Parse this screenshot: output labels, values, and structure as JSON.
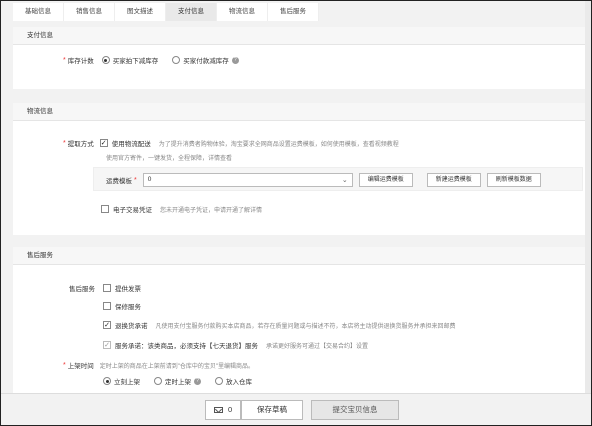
{
  "tabs": [
    {
      "label": "基础信息"
    },
    {
      "label": "销售信息"
    },
    {
      "label": "图文描述"
    },
    {
      "label": "支付信息"
    },
    {
      "label": "物流信息"
    },
    {
      "label": "售后服务"
    }
  ],
  "payment": {
    "title": "支付信息",
    "stock_label": "库存计数",
    "opt1": "买家拍下减库存",
    "opt2": "买家付款减库存"
  },
  "logistics": {
    "title": "物流信息",
    "method_label": "提取方式",
    "use_logistics": "使用物流配送",
    "desc": "为了提升消费者购物体验，淘宝要求全网商品设置运费模板，如何使用模板，查看视频教程",
    "desc2": "使用官方寄件，一键发货，全程保障，详情查看",
    "template_label": "运费模板",
    "template_value": "0",
    "btn_edit": "编辑运费模板",
    "btn_new": "新建运费模板",
    "btn_refresh": "刷新模板数据",
    "voucher_label": "电子交易凭证",
    "voucher_hint": "您未开通电子凭证，申请开通了解详情"
  },
  "after_sales": {
    "title": "售后服务",
    "service_label": "售后服务",
    "invoice": "提供发票",
    "warranty": "保修服务",
    "return_promise": "退换货承诺",
    "return_hint": "凡使用支付宝服务付款购买本店商品，若存在质量问题或与描述不符，本店将主动提供退换货服务并承担来回邮费",
    "service_promise": "服务承诺：该类商品，必须支持【七天退货】服务",
    "service_hint": "承诺更好服务可通过【交易合约】设置",
    "listing_label": "上架时间",
    "listing_hint": "定时上架的商品在上架前请到\"仓库中的宝贝\"里编辑商品。",
    "opt_now": "立刻上架",
    "opt_timed": "定时上架",
    "opt_warehouse": "放入仓库"
  },
  "footer": {
    "mail_count": "0",
    "save_draft": "保存草稿",
    "submit": "提交宝贝信息"
  }
}
